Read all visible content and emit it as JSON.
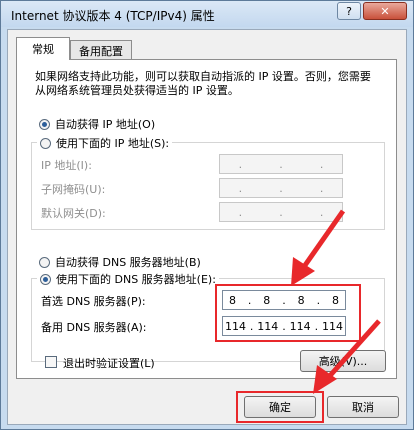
{
  "window": {
    "title": "Internet 协议版本 4 (TCP/IPv4) 属性",
    "help_label": "?",
    "close_label": "✕"
  },
  "tabs": [
    {
      "label": "常规"
    },
    {
      "label": "备用配置"
    }
  ],
  "description": "如果网络支持此功能，则可以获取自动指派的 IP 设置。否则，您需要从网络系统管理员处获得适当的 IP 设置。",
  "ip": {
    "auto_label": "自动获得 IP 地址(O)",
    "manual_label": "使用下面的 IP 地址(S):",
    "fields": [
      {
        "label": "IP 地址(I):"
      },
      {
        "label": "子网掩码(U):"
      },
      {
        "label": "默认网关(D):"
      }
    ],
    "dot": "."
  },
  "dns": {
    "auto_label": "自动获得 DNS 服务器地址(B)",
    "manual_label": "使用下面的 DNS 服务器地址(E):",
    "preferred": {
      "label": "首选 DNS 服务器(P):",
      "octets": [
        "8",
        "8",
        "8",
        "8"
      ]
    },
    "alternate": {
      "label": "备用 DNS 服务器(A):",
      "octets": [
        "114",
        "114",
        "114",
        "114"
      ]
    }
  },
  "validate_label": "退出时验证设置(L)",
  "advanced_label": "高级(V)...",
  "ok_label": "确定",
  "cancel_label": "取消",
  "colors": {
    "highlight": "#e8282b",
    "accent": "#2d5f9a"
  }
}
